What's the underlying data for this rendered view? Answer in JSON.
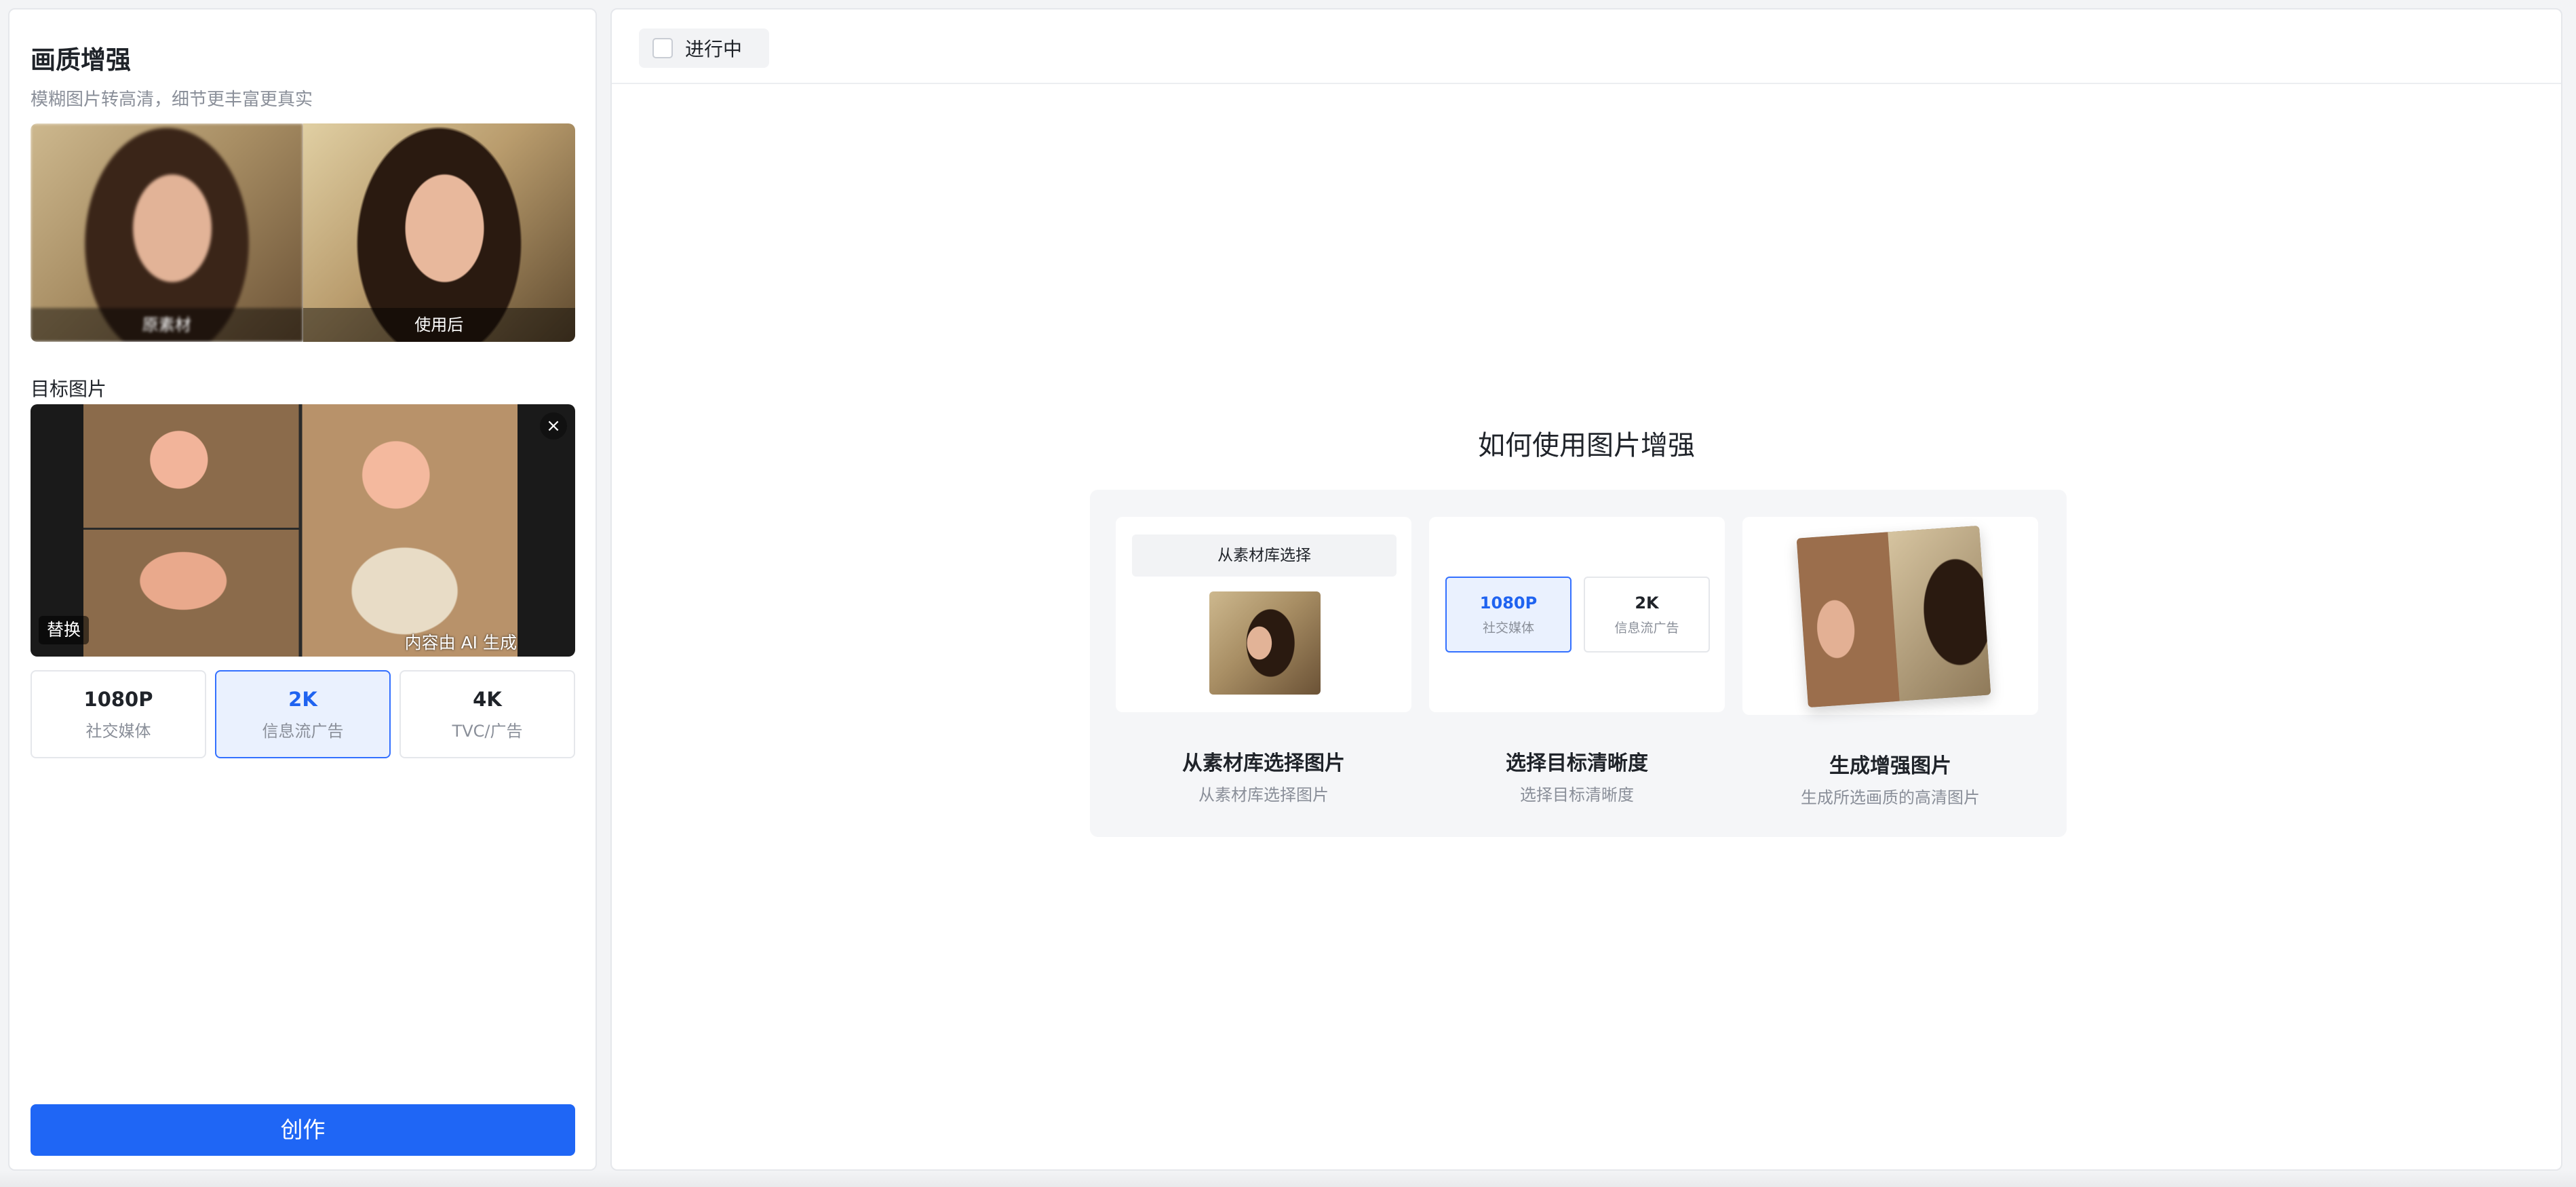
{
  "left_panel": {
    "title": "画质增强",
    "subtitle": "模糊图片转高清，细节更丰富更真实",
    "compare": {
      "before_label": "原素材",
      "after_label": "使用后"
    },
    "target_section_label": "目标图片",
    "target_image": {
      "close_symbol": "×",
      "replace_label": "替换",
      "ai_label": "内容由 AI 生成"
    },
    "resolutions": [
      {
        "main": "1080P",
        "sub": "社交媒体",
        "selected": false
      },
      {
        "main": "2K",
        "sub": "信息流广告",
        "selected": true
      },
      {
        "main": "4K",
        "sub": "TVC/广告",
        "selected": false
      }
    ],
    "create_label": "创作"
  },
  "right_panel": {
    "filter_label": "进行中",
    "howto": {
      "title": "如何使用图片增强",
      "steps": [
        {
          "title": "从素材库选择图片",
          "desc": "从素材库选择图片",
          "button_label": "从素材库选择"
        },
        {
          "title": "选择目标清晰度",
          "desc": "选择目标清晰度",
          "options": [
            {
              "main": "1080P",
              "sub": "社交媒体",
              "selected": true
            },
            {
              "main": "2K",
              "sub": "信息流广告",
              "selected": false
            }
          ]
        },
        {
          "title": "生成增强图片",
          "desc": "生成所选画质的高清图片"
        }
      ]
    }
  },
  "colors": {
    "accent": "#1f66f5",
    "selected_border": "#3370ff",
    "selected_bg": "#eaf1fe"
  }
}
